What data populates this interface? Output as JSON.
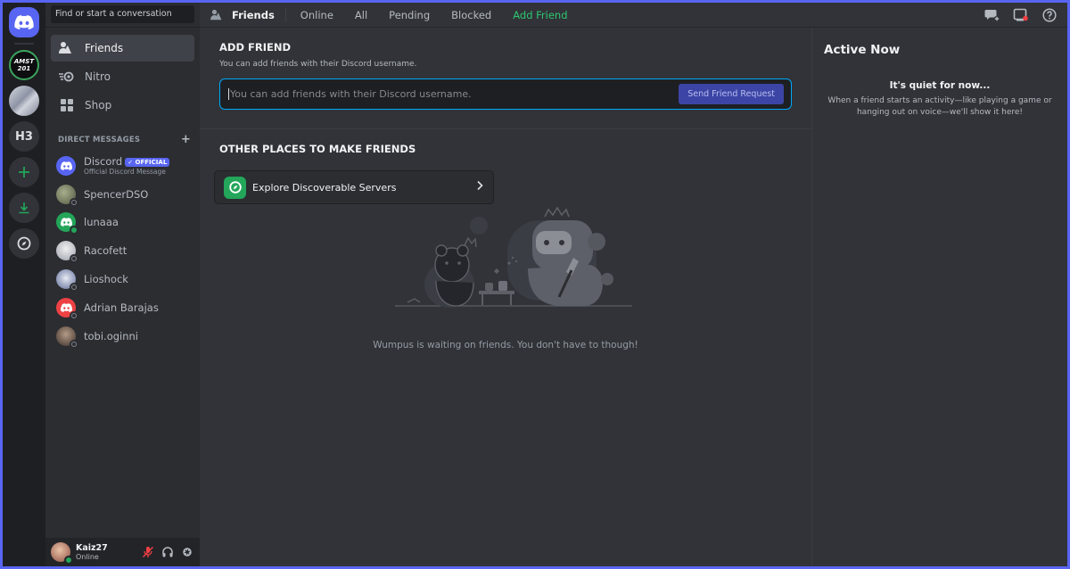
{
  "servers": {
    "home_icon": "discord-logo-icon",
    "items": [
      {
        "label": "AMST\n201"
      },
      {
        "label": ""
      },
      {
        "label": "H3"
      }
    ],
    "add_icon": "plus-icon",
    "download_icon": "download-icon",
    "explore_icon": "compass-icon"
  },
  "sidebar": {
    "search_placeholder": "Find or start a conversation",
    "nav": [
      {
        "label": "Friends",
        "icon": "friends-icon"
      },
      {
        "label": "Nitro",
        "icon": "nitro-icon"
      },
      {
        "label": "Shop",
        "icon": "shop-icon"
      }
    ],
    "dm_header": "DIRECT MESSAGES",
    "dm_add": "+",
    "dms": [
      {
        "name": "Discord",
        "badge": "OFFICIAL",
        "sub": "Official Discord Message",
        "color": "#5865f2"
      },
      {
        "name": "SpencerDSO",
        "color": "#6d7760"
      },
      {
        "name": "lunaaa",
        "color": "#23a55a"
      },
      {
        "name": "Racofett",
        "color": "#c8ccd4"
      },
      {
        "name": "Lioshock",
        "color": "#8f9bbd"
      },
      {
        "name": "Adrian Barajas",
        "color": "#ed4245"
      },
      {
        "name": "tobi.oginni",
        "color": "#5c4a40"
      }
    ],
    "user": {
      "name": "Kaiz27",
      "status": "Online"
    }
  },
  "header": {
    "title": "Friends",
    "tabs": [
      "Online",
      "All",
      "Pending",
      "Blocked"
    ],
    "add_friend_tab": "Add Friend"
  },
  "add_friend": {
    "title": "ADD FRIEND",
    "subtitle": "You can add friends with their Discord username.",
    "placeholder": "You can add friends with their Discord username.",
    "button": "Send Friend Request"
  },
  "other_places": {
    "title": "OTHER PLACES TO MAKE FRIENDS",
    "explore_label": "Explore Discoverable Servers"
  },
  "wumpus_text": "Wumpus is waiting on friends. You don't have to though!",
  "active_now": {
    "title": "Active Now",
    "quiet": "It's quiet for now...",
    "desc": "When a friend starts an activity—like playing a game or hanging out on voice—we'll show it here!"
  },
  "colors": {
    "brand": "#5865f2",
    "green": "#23a55a",
    "background": "#313338"
  }
}
